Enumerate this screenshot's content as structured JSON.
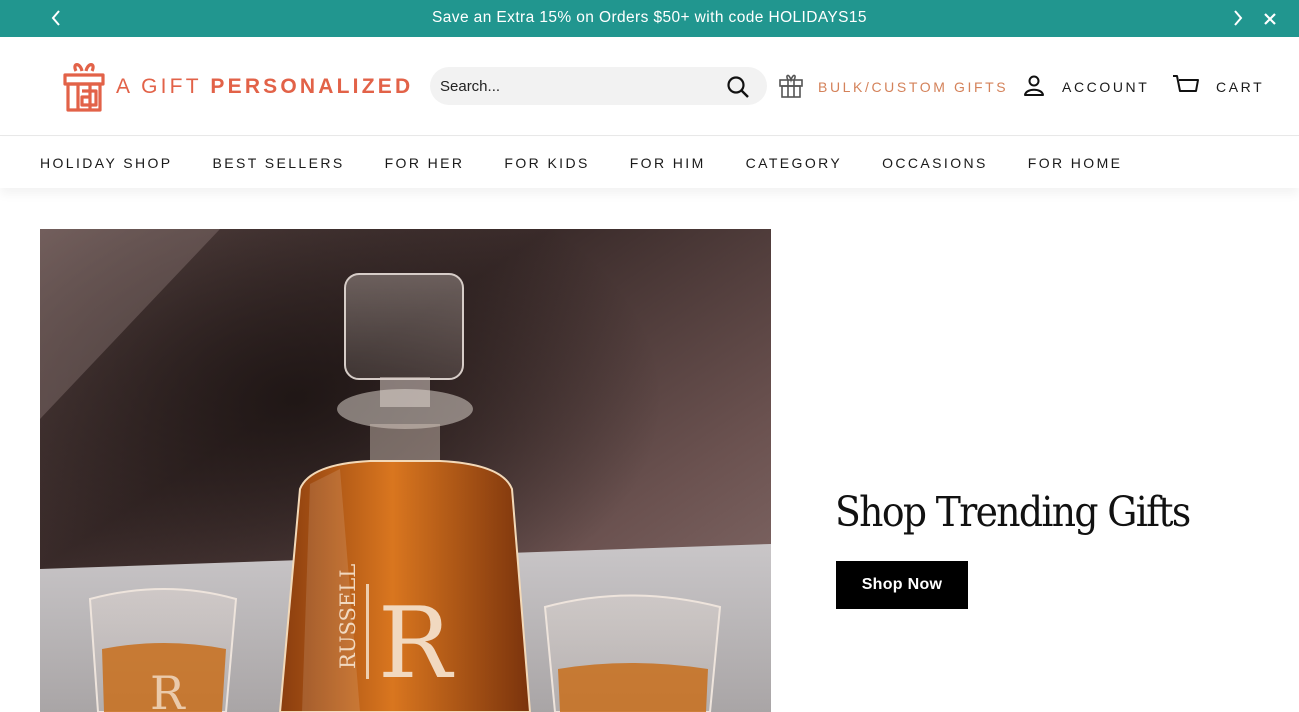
{
  "announcement": {
    "message": "Save an Extra 15% on Orders $50+ with code HOLIDAYS15",
    "prev_icon": "chevron-left-icon",
    "next_icon": "chevron-right-icon",
    "close_icon": "close-icon"
  },
  "header": {
    "logo": {
      "word_a": "A",
      "word_gift": "GIFT",
      "word_personalized": "PERSONALIZED",
      "icon": "gift-box-logo-icon"
    },
    "search": {
      "placeholder": "Search...",
      "icon": "search-icon"
    },
    "bulk_label": "BULK/CUSTOM GIFTS",
    "account_label": "ACCOUNT",
    "cart_label": "CART"
  },
  "nav": {
    "items": [
      "HOLIDAY SHOP",
      "BEST SELLERS",
      "FOR HER",
      "FOR KIDS",
      "FOR HIM",
      "CATEGORY",
      "OCCASIONS",
      "FOR HOME"
    ]
  },
  "hero": {
    "title": "Shop Trending Gifts",
    "button_label": "Shop Now",
    "engraving_name": "RUSSELL",
    "engraving_initial": "R"
  },
  "colors": {
    "announcement_bg": "#21968f",
    "brand_coral": "#e26248",
    "bulk_label": "#d4825a",
    "button_bg": "#000000"
  }
}
